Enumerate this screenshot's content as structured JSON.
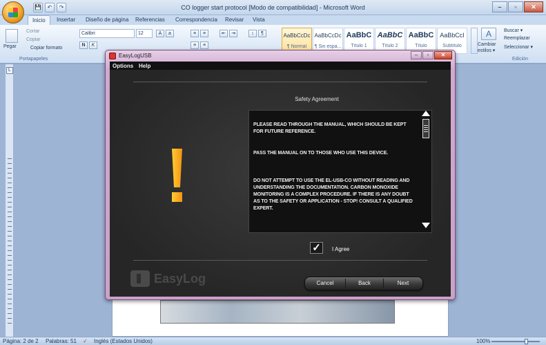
{
  "word": {
    "title": "CO logger start protocol [Modo de compatibilidad] - Microsoft Word",
    "quick_access": [
      "💾",
      "↶",
      "↷"
    ],
    "window_controls": {
      "minimize": "–",
      "maximize": "▫",
      "close": "✕"
    },
    "tabs": [
      "Inicio",
      "Insertar",
      "Diseño de página",
      "Referencias",
      "Correspondencia",
      "Revisar",
      "Vista"
    ],
    "clipboard": {
      "paste": "Pegar",
      "cut": "Cortar",
      "copy": "Copiar",
      "format_painter": "Copiar formato",
      "group": "Portapapeles"
    },
    "font": {
      "name": "Calibri",
      "size": "12"
    },
    "styles": [
      {
        "sample": "AaBbCcDc",
        "name": "¶ Normal"
      },
      {
        "sample": "AaBbCcDc",
        "name": "¶ Sin espa..."
      },
      {
        "sample": "AaBbC",
        "name": "Título 1"
      },
      {
        "sample": "AaBbC",
        "name": "Título 2"
      },
      {
        "sample": "AaBbC",
        "name": "Título"
      },
      {
        "sample": "AaBbCcI",
        "name": "Subtítulo"
      }
    ],
    "change_styles": [
      "Cambiar",
      "estilos ▾"
    ],
    "editing": {
      "find": "Buscar ▾",
      "replace": "Reemplazar",
      "select": "Seleccionar ▾",
      "group": "Edición"
    },
    "status": {
      "page": "Página: 2 de 2",
      "words": "Palabras: 51",
      "language": "Inglés (Estados Unidos)",
      "zoom": "100%"
    }
  },
  "dialog": {
    "title": "EasyLogUSB",
    "menu": [
      "Options",
      "Help"
    ],
    "heading": "Safety Agreement",
    "paragraphs": [
      "PLEASE READ THROUGH THE MANUAL, WHICH SHOULD BE KEPT FOR FUTURE REFERENCE.",
      "PASS THE MANUAL ON TO THOSE WHO USE THIS DEVICE.",
      "DO NOT ATTEMPT TO USE THE EL-USB-CO WITHOUT READING AND UNDERSTANDING THE DOCUMENTATION. CARBON MONOXIDE MONITORING IS A COMPLEX PROCEDURE. IF THERE IS ANY DOUBT AS TO THE SAFETY OR APPLICATION - STOP! CONSULT A QUALIFIED EXPERT."
    ],
    "agree_checked": true,
    "agree_mark": "✓",
    "agree_label": "I Agree",
    "logo_text": "EasyLog",
    "buttons": {
      "cancel": "Cancel",
      "back": "Back",
      "next": "Next"
    },
    "warning_color": "#f7a21b"
  }
}
